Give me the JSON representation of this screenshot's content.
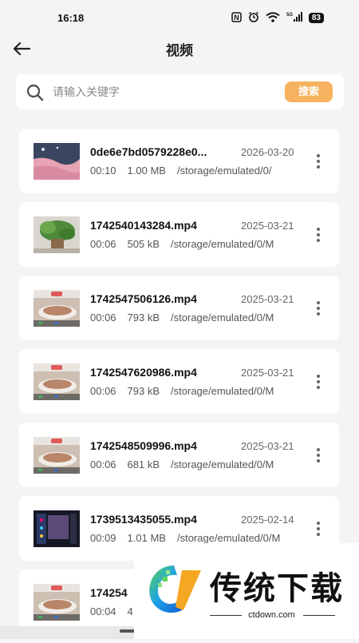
{
  "status_bar": {
    "time": "16:18",
    "network": "5G",
    "battery": "83",
    "icons": [
      "nfc-icon",
      "alarm-icon",
      "wifi-icon",
      "signal-icon",
      "battery-icon"
    ]
  },
  "header": {
    "title": "视频",
    "back_icon": "back-arrow-icon"
  },
  "search": {
    "placeholder": "请输入关键字",
    "value": "",
    "button_label": "搜索",
    "icon": "search-icon"
  },
  "videos": [
    {
      "name": "0de6e7bd0579228e0...",
      "date": "2026-03-20",
      "duration": "00:10",
      "size": "1.00 MB",
      "path": "/storage/emulated/0/",
      "thumb": "pink-sky"
    },
    {
      "name": "1742540143284.mp4",
      "date": "2025-03-21",
      "duration": "00:06",
      "size": "505 kB",
      "path": "/storage/emulated/0/M",
      "thumb": "plant"
    },
    {
      "name": "1742547506126.mp4",
      "date": "2025-03-21",
      "duration": "00:06",
      "size": "793 kB",
      "path": "/storage/emulated/0/M",
      "thumb": "shoe"
    },
    {
      "name": "1742547620986.mp4",
      "date": "2025-03-21",
      "duration": "00:06",
      "size": "793 kB",
      "path": "/storage/emulated/0/M",
      "thumb": "shoe"
    },
    {
      "name": "1742548509996.mp4",
      "date": "2025-03-21",
      "duration": "00:06",
      "size": "681 kB",
      "path": "/storage/emulated/0/M",
      "thumb": "shoe"
    },
    {
      "name": "1739513435055.mp4",
      "date": "2025-02-14",
      "duration": "00:09",
      "size": "1.01 MB",
      "path": "/storage/emulated/0/M",
      "thumb": "dark-screen"
    },
    {
      "name": "174254",
      "date": "",
      "duration": "00:04",
      "size": "4",
      "path": "",
      "thumb": "shoe"
    }
  ],
  "watermark": {
    "title": "传统下载",
    "domain": "ctdown.com"
  },
  "colors": {
    "accent": "#f7b25f",
    "background": "#f4f4f4",
    "card": "#ffffff"
  }
}
